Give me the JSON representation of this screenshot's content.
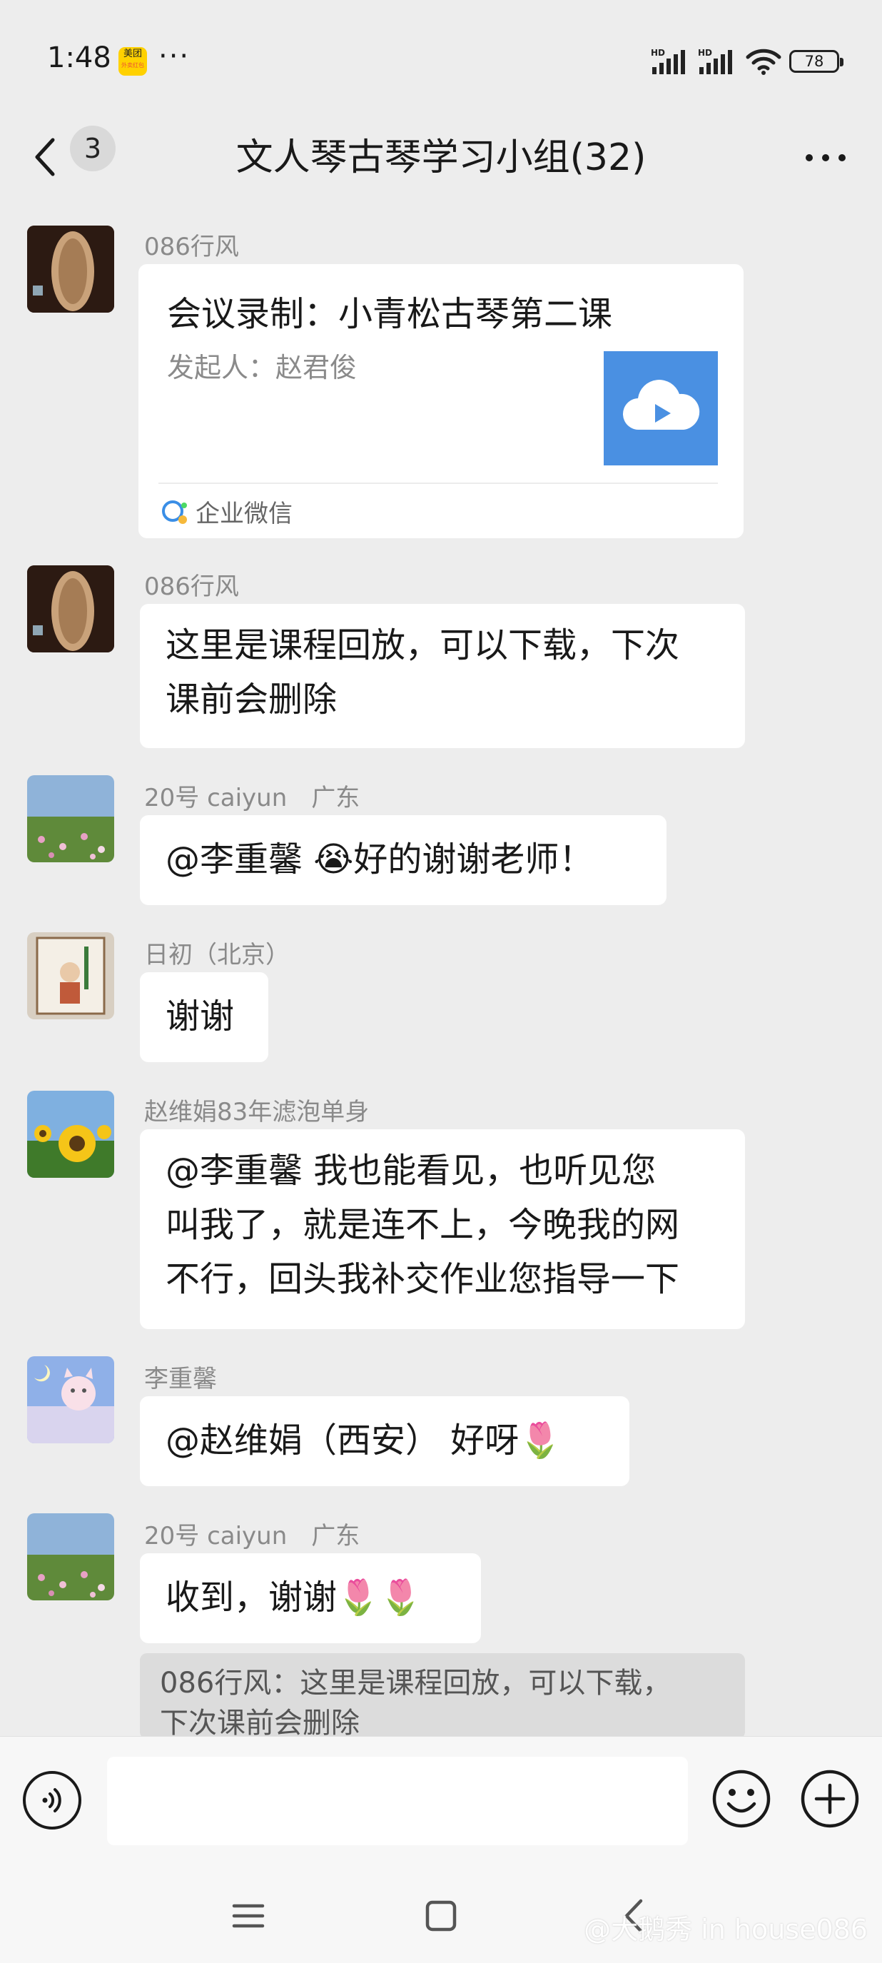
{
  "status_bar": {
    "time": "1:48",
    "app_badge": "美团",
    "app_badge_sub": "外卖红包",
    "dots": "···",
    "signal1_label": "HD",
    "signal2_label": "HD",
    "battery": "78"
  },
  "nav": {
    "unread_count": "3",
    "title": "文人琴古琴学习小组(32)"
  },
  "messages": [
    {
      "sender": "086行风",
      "type": "card",
      "card_title": "会议录制：小青松古琴第二课",
      "card_subtitle": "发起人：赵君俊",
      "card_source": "企业微信"
    },
    {
      "sender": "086行风",
      "line1": "这里是课程回放，可以下载，下次",
      "line2": "课前会删除"
    },
    {
      "sender": "20号 caiyun　广东",
      "pre": "@李重馨 ",
      "emoji": "😭",
      "post": "好的谢谢老师！"
    },
    {
      "sender": "日初（北京）",
      "text": "谢谢"
    },
    {
      "sender": "赵维娟83年滤泡单身",
      "line1": "@李重馨  我也能看见，也听见您",
      "line2": "叫我了，就是连不上，今晚我的网",
      "line3": "不行，回头我补交作业您指导一下"
    },
    {
      "sender": "李重馨",
      "text": "@赵维娟（西安） 好呀",
      "emoji": "🌷"
    },
    {
      "sender": "20号 caiyun　广东",
      "text": "收到，谢谢",
      "emoji": "🌷🌷"
    }
  ],
  "quote": {
    "line1": "086行风：这里是课程回放，可以下载，",
    "line2": "下次课前会删除"
  },
  "input": {
    "placeholder": ""
  },
  "watermark": "@大鹅秀 in house086"
}
